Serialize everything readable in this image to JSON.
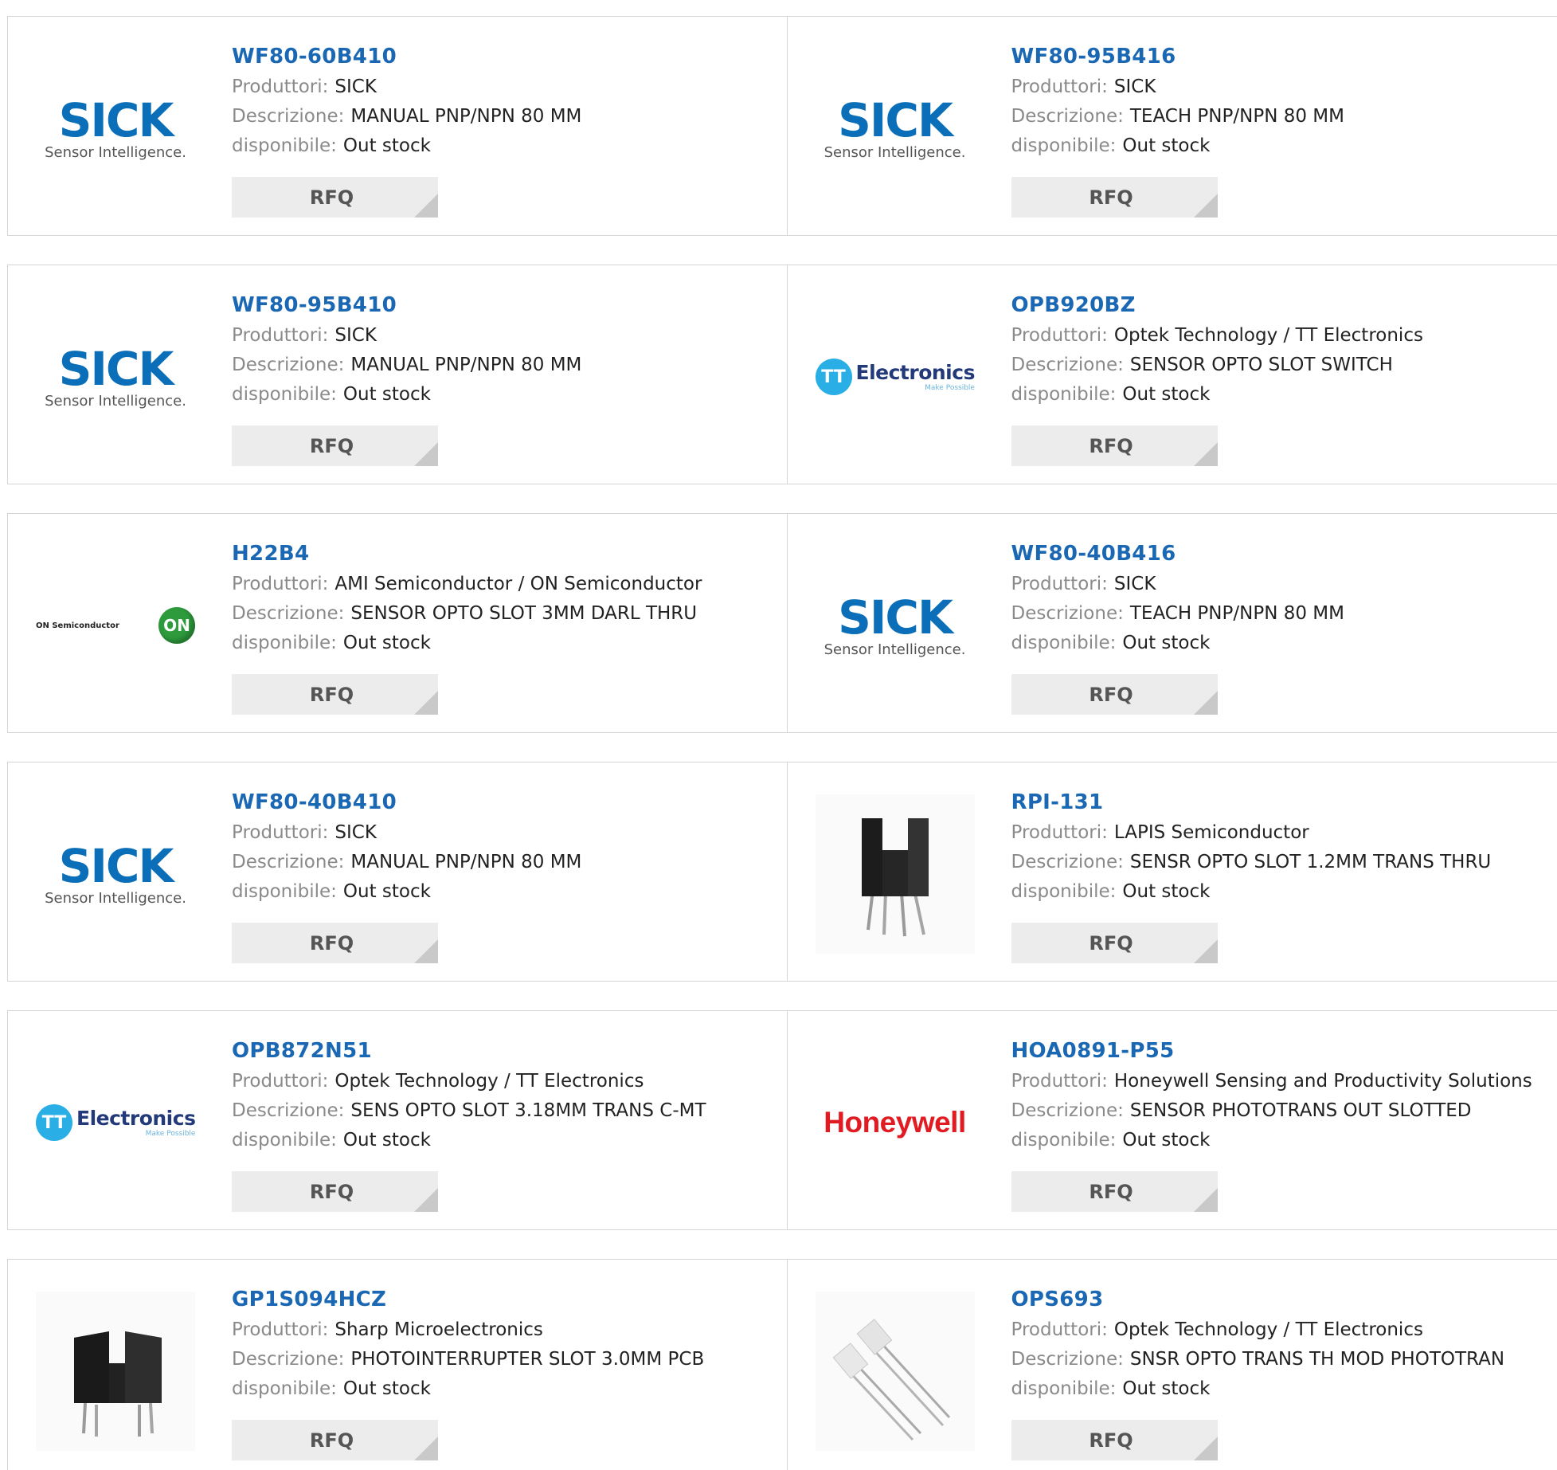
{
  "labels": {
    "manufacturer": "Produttori:",
    "description": "Descrizione:",
    "availability": "disponibile:",
    "rfq": "RFQ"
  },
  "logos": {
    "sick_word": "SICK",
    "sick_tag": "Sensor Intelligence.",
    "tt_mark": "TT",
    "tt_word": "Electronics",
    "tt_tag": "Make Possible",
    "on_word": "ON Semiconductor",
    "on_mark": "ON",
    "honeywell": "Honeywell"
  },
  "products": [
    {
      "pn": "WF80-60B410",
      "mfr": "SICK",
      "desc": "MANUAL PNP/NPN 80 MM",
      "stock": "Out stock",
      "logo": "sick"
    },
    {
      "pn": "WF80-95B416",
      "mfr": "SICK",
      "desc": "TEACH PNP/NPN 80 MM",
      "stock": "Out stock",
      "logo": "sick"
    },
    {
      "pn": "WF80-95B410",
      "mfr": "SICK",
      "desc": "MANUAL PNP/NPN 80 MM",
      "stock": "Out stock",
      "logo": "sick"
    },
    {
      "pn": "OPB920BZ",
      "mfr": "Optek Technology / TT Electronics",
      "desc": "SENSOR OPTO SLOT SWITCH",
      "stock": "Out stock",
      "logo": "tt"
    },
    {
      "pn": "H22B4",
      "mfr": "AMI Semiconductor / ON Semiconductor",
      "desc": "SENSOR OPTO SLOT 3MM DARL THRU",
      "stock": "Out stock",
      "logo": "on"
    },
    {
      "pn": "WF80-40B416",
      "mfr": "SICK",
      "desc": "TEACH PNP/NPN 80 MM",
      "stock": "Out stock",
      "logo": "sick"
    },
    {
      "pn": "WF80-40B410",
      "mfr": "SICK",
      "desc": "MANUAL PNP/NPN 80 MM",
      "stock": "Out stock",
      "logo": "sick"
    },
    {
      "pn": "RPI-131",
      "mfr": "LAPIS Semiconductor",
      "desc": "SENSR OPTO SLOT 1.2MM TRANS THRU",
      "stock": "Out stock",
      "logo": "rpi-photo"
    },
    {
      "pn": "OPB872N51",
      "mfr": "Optek Technology / TT Electronics",
      "desc": "SENS OPTO SLOT 3.18MM TRANS C-MT",
      "stock": "Out stock",
      "logo": "tt"
    },
    {
      "pn": "HOA0891-P55",
      "mfr": "Honeywell Sensing and Productivity Solutions",
      "desc": "SENSOR PHOTOTRANS OUT SLOTTED",
      "stock": "Out stock",
      "logo": "honeywell"
    },
    {
      "pn": "GP1S094HCZ",
      "mfr": "Sharp Microelectronics",
      "desc": "PHOTOINTERRUPTER SLOT 3.0MM PCB",
      "stock": "Out stock",
      "logo": "gp-photo"
    },
    {
      "pn": "OPS693",
      "mfr": "Optek Technology / TT Electronics",
      "desc": "SNSR OPTO TRANS TH MOD PHOTOTRAN",
      "stock": "Out stock",
      "logo": "ops-photo"
    }
  ]
}
